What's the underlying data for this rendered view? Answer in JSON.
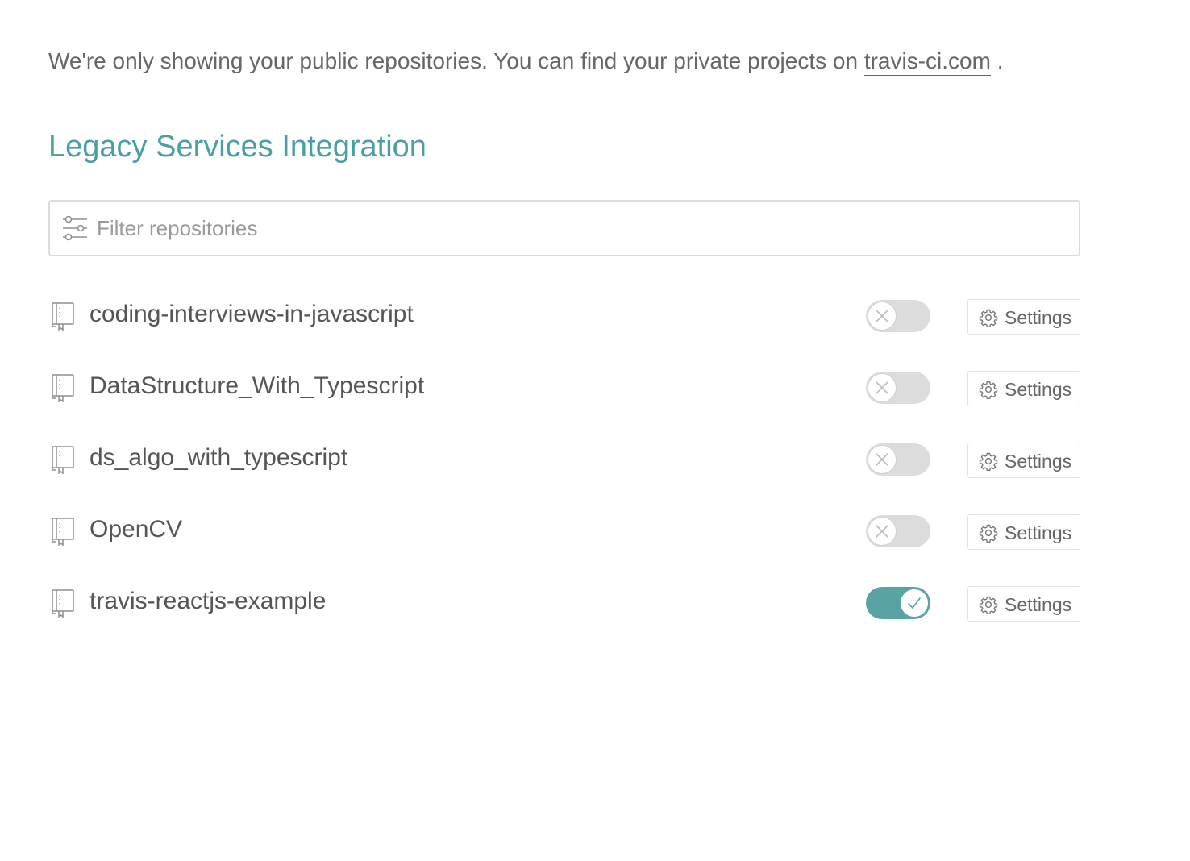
{
  "notice": {
    "text": "We're only showing your public repositories. You can find your private projects on ",
    "link_text": "travis-ci.com",
    "trailing": "."
  },
  "section": {
    "title": "Legacy Services Integration"
  },
  "filter": {
    "placeholder": "Filter repositories",
    "value": "",
    "icon": "sliders-icon"
  },
  "colors": {
    "accent": "#4a9fa0",
    "toggle_on": "#5aa3a3",
    "toggle_off": "#dcdcdc",
    "text": "#666666"
  },
  "repos": [
    {
      "name": "coding-interviews-in-javascript",
      "active": false,
      "settings_label": "Settings"
    },
    {
      "name": "DataStructure_With_Typescript",
      "active": false,
      "settings_label": "Settings"
    },
    {
      "name": "ds_algo_with_typescript",
      "active": false,
      "settings_label": "Settings"
    },
    {
      "name": "OpenCV",
      "active": false,
      "settings_label": "Settings"
    },
    {
      "name": "travis-reactjs-example",
      "active": true,
      "settings_label": "Settings"
    }
  ]
}
